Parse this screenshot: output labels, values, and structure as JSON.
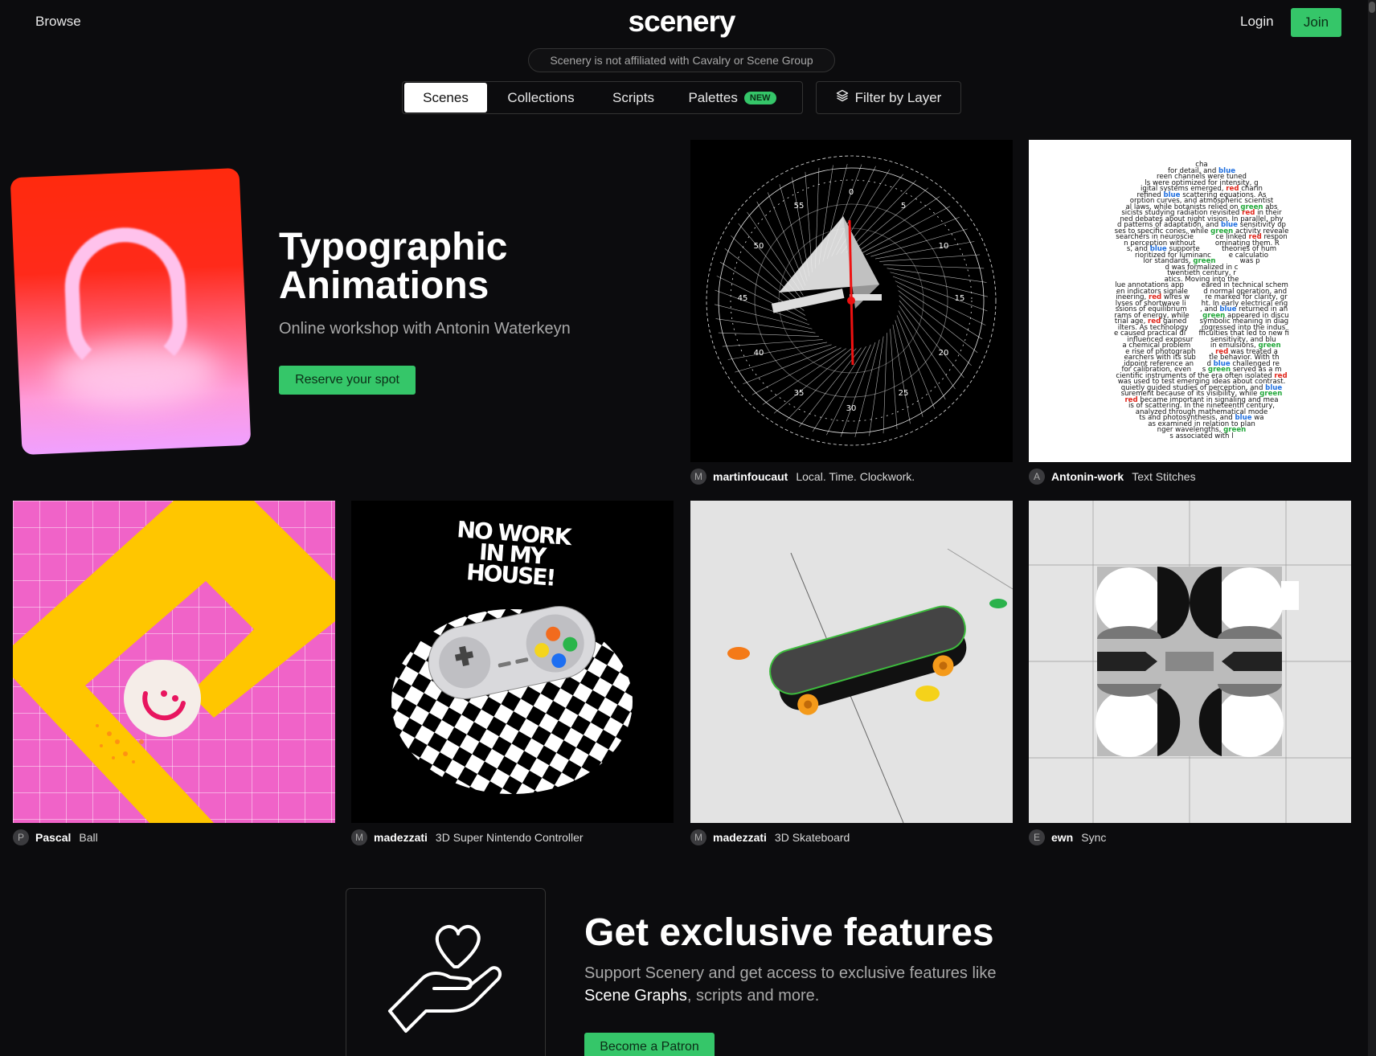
{
  "header": {
    "browse_label": "Browse",
    "logo": "scenery",
    "login_label": "Login",
    "join_label": "Join"
  },
  "notice": "Scenery is not affiliated with Cavalry or Scene Group",
  "tabs": [
    {
      "label": "Scenes",
      "active": true
    },
    {
      "label": "Collections"
    },
    {
      "label": "Scripts"
    },
    {
      "label": "Palettes",
      "badge": "NEW"
    }
  ],
  "filter_label": "Filter by Layer",
  "hero": {
    "title": "Typographic Animations",
    "subtitle": "Online workshop with Antonin Waterkeyn",
    "button": "Reserve your spot"
  },
  "cards": [
    {
      "avatar": "M",
      "author": "martinfoucaut",
      "title": "Local. Time. Clockwork."
    },
    {
      "avatar": "A",
      "author": "Antonin-work",
      "title": "Text Stitches"
    },
    {
      "avatar": "P",
      "author": "Pascal",
      "title": "Ball"
    },
    {
      "avatar": "M",
      "author": "madezzati",
      "title": "3D Super Nintendo Controller"
    },
    {
      "avatar": "M",
      "author": "madezzati",
      "title": "3D Skateboard"
    },
    {
      "avatar": "E",
      "author": "ewn",
      "title": "Sync"
    }
  ],
  "artwork_text": {
    "controller_text": "NO WORK IN MY HOUSE!",
    "text_stitches_lines": [
      "cha",
      "for detail, and blue",
      "reen channels were tuned",
      "ls were optimized for intensity, g",
      "igital systems emerged, red charin",
      "refined blue scattering equations. As",
      "orption curves, and atmospheric scientist",
      "al laws, while botanists relied on green abs",
      "sicists studying radiation revisited red in their",
      "ned debates about night vision. In parallel, phy",
      "d patterns of adaptation, and blue sensitivity op",
      "ses to specific cones, while green activity reveale",
      "searchers in neuroscie          ce linked red respon",
      "n perception without         ominating them. R",
      "s, and blue supporte          theories of hum",
      "rioritized for luminanc        e calculatio",
      "lor standards, green           was p",
      "d was formalized in c",
      "twentieth century, r",
      "atics. Moving into the",
      "lue annotations app        eared in technical schem",
      "en indicators signale       d normal operation, and",
      "ineering, red wires w       re marked for clarity, gr",
      "lyses of shortwave li       ht. In early electrical eng",
      "ssions of equilibrium      , and blue returned in an",
      "rams of energy, while      green appeared in discu",
      "trial age, red gained      symbolic meaning in diag",
      "ilters. As technology      rogressed into the indus",
      "e caused practical di      fficulties that led to new fi",
      "influenced exposur        sensitivity, and blu",
      "a chemical problem         in emulsions, green",
      "e rise of photograph       , red was treated a",
      "earchers with its sub      tle behavior. With th",
      "idpoint reference an      d blue challenged re",
      "for calibration, even     s green served as a m",
      "cientific instruments of the era often isolated red",
      "was used to test emerging ideas about contrast.",
      "quietly guided studies of perception, and blue",
      "surement because of its visibility, while green",
      "red became important in signaling and mea",
      "is of scattering. In the nineteenth century,",
      "analyzed through mathematical mode",
      "ts and photosynthesis, and blue wa",
      "as examined in relation to plan",
      "nger wavelengths, green",
      "s associated with l"
    ]
  },
  "promo": {
    "title": "Get exclusive features",
    "text_before": "Support Scenery and get access to exclusive features like ",
    "text_highlight": "Scene Graphs",
    "text_after": ", scripts and more.",
    "button": "Become a Patron"
  },
  "icons": {
    "filter": "layers-icon",
    "promo": "heart-in-hand-icon"
  },
  "colors": {
    "accent": "#35c669",
    "background": "#0c0c0e"
  }
}
